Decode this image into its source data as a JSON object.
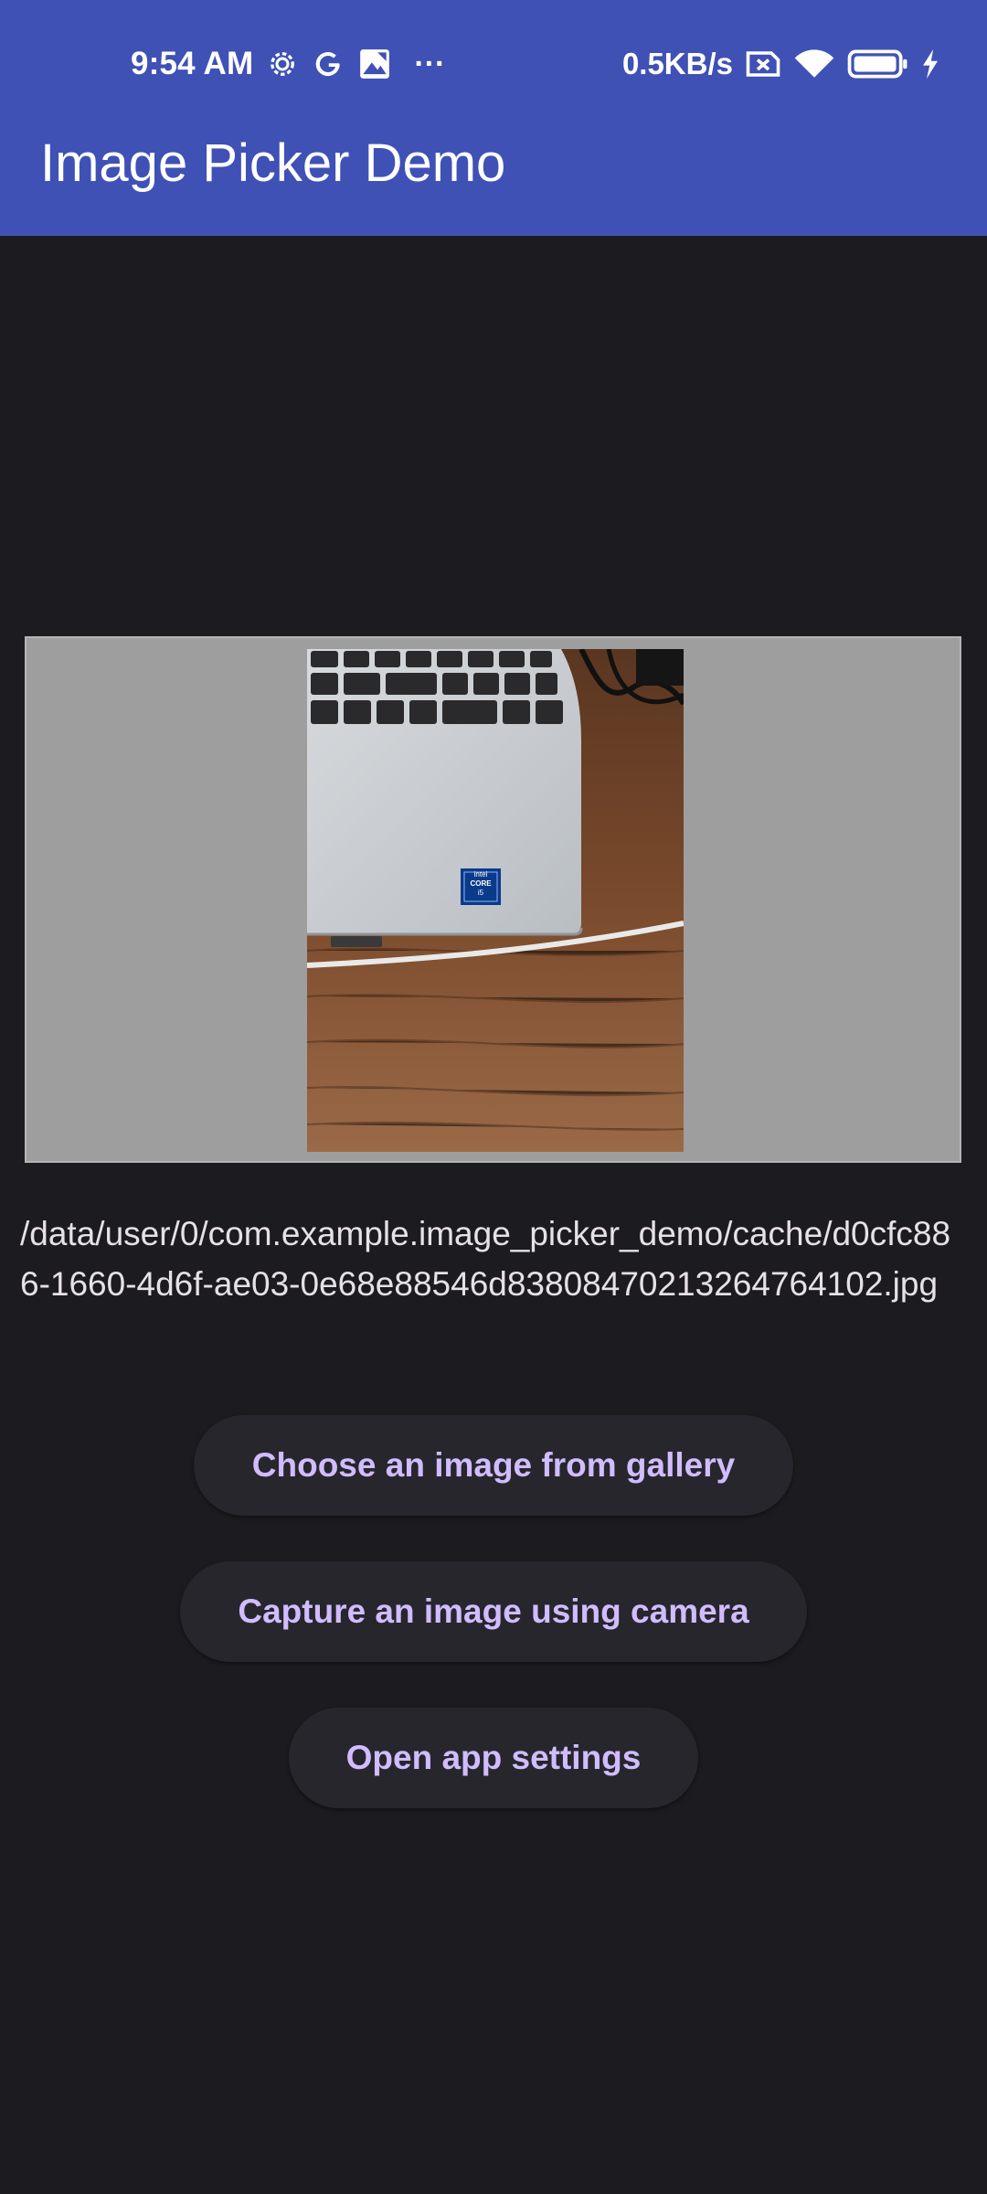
{
  "status_bar": {
    "time": "9:54 AM",
    "more_indicator": "···",
    "network_speed": "0.5KB/s",
    "icons": [
      "gear-icon",
      "google-icon",
      "gallery-notification-icon",
      "sim-error-icon",
      "wifi-icon",
      "battery-icon",
      "charging-bolt-icon"
    ]
  },
  "app_bar": {
    "title": "Image Picker Demo",
    "color": "#3f51b5"
  },
  "image_preview": {
    "description_icon": "picked-photo",
    "sticker_line1": "intel",
    "sticker_line2": "CORE",
    "sticker_line3": "i5"
  },
  "file_path": "/data/user/0/com.example.image_picker_demo/cache/d0cfc886-1660-4d6f-ae03-0e68e88546d8380847021326476410​2.jpg",
  "buttons": {
    "gallery": "Choose an image from gallery",
    "camera": "Capture an image using camera",
    "settings": "Open app settings"
  },
  "theme": {
    "background": "#1c1b20",
    "button_text": "#d0bcff",
    "button_background": "#27262c"
  }
}
